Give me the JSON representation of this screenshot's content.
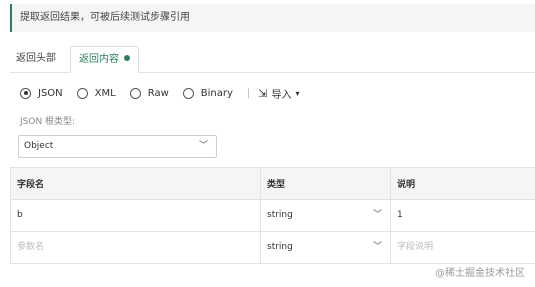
{
  "tip": {
    "text": "提取返回结果，可被后续测试步骤引用"
  },
  "tabs": [
    {
      "label": "返回头部",
      "active": false
    },
    {
      "label": "返回内容",
      "active": true
    }
  ],
  "body_types": {
    "options": [
      "JSON",
      "XML",
      "Raw",
      "Binary"
    ],
    "selected": "JSON",
    "import_label": "导入"
  },
  "root_type": {
    "label": "JSON 根类型:",
    "value": "Object"
  },
  "table": {
    "headers": [
      "字段名",
      "类型",
      "说明"
    ],
    "rows": [
      {
        "name": "b",
        "type": "string",
        "desc": "1"
      },
      {
        "name_placeholder": "参数名",
        "type": "string",
        "desc_placeholder": "字段说明"
      }
    ]
  },
  "watermark": "@稀土掘金技术社区",
  "colors": {
    "accent": "#2e7d58"
  },
  "icons": {
    "radio": "radio-icon",
    "import": "import-icon",
    "dropdown": "chevron-down-icon",
    "status": "status-dot-icon"
  }
}
